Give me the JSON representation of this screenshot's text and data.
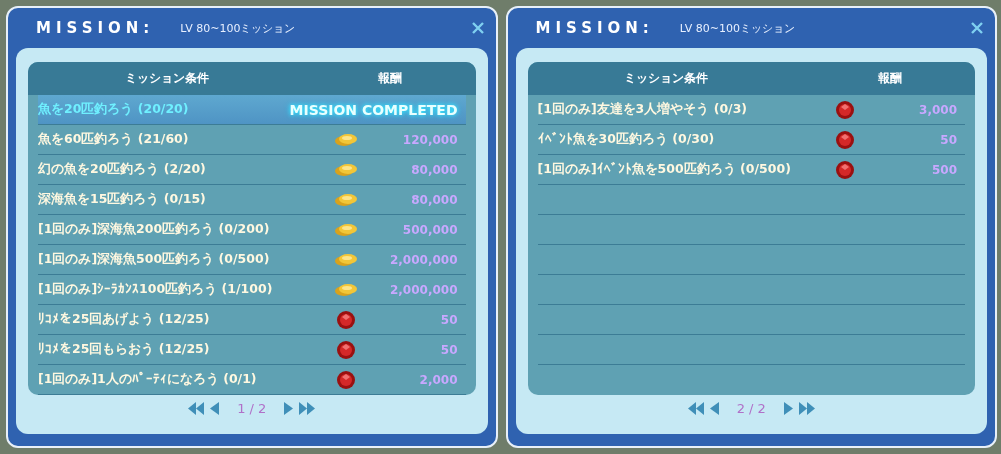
{
  "panels": [
    {
      "title": "MISSION:",
      "subtitle": "LV 80~100ミッション",
      "columns": [
        "ミッション条件",
        "報酬"
      ],
      "rows": [
        {
          "kind": "completed",
          "selected": true,
          "condition": "魚を20匹釣ろう (20/20)",
          "status": "MISSION COMPLETED"
        },
        {
          "kind": "coin",
          "selected": false,
          "condition": "魚を60匹釣ろう (21/60)",
          "reward": "120,000"
        },
        {
          "kind": "coin",
          "selected": false,
          "condition": "幻の魚を20匹釣ろう (2/20)",
          "reward": "80,000"
        },
        {
          "kind": "coin",
          "selected": false,
          "condition": "深海魚を15匹釣ろう (0/15)",
          "reward": "80,000"
        },
        {
          "kind": "coin",
          "selected": false,
          "condition": "[1回のみ]深海魚200匹釣ろう (0/200)",
          "reward": "500,000"
        },
        {
          "kind": "coin",
          "selected": false,
          "condition": "[1回のみ]深海魚500匹釣ろう (0/500)",
          "reward": "2,000,000"
        },
        {
          "kind": "coin",
          "selected": false,
          "condition": "[1回のみ]ｼｰﾗｶﾝｽ100匹釣ろう (1/100)",
          "reward": "2,000,000"
        },
        {
          "kind": "gem",
          "selected": false,
          "condition": "ﾘｺﾒを25回あげよう (12/25)",
          "reward": "50"
        },
        {
          "kind": "gem",
          "selected": false,
          "condition": "ﾘｺﾒを25回もらおう (12/25)",
          "reward": "50"
        },
        {
          "kind": "gem",
          "selected": false,
          "condition": "[1回のみ]1人のﾊﾟｰﾃｨになろう (0/1)",
          "reward": "2,000"
        }
      ],
      "page": "1 / 2"
    },
    {
      "title": "MISSION:",
      "subtitle": "LV 80~100ミッション",
      "columns": [
        "ミッション条件",
        "報酬"
      ],
      "rows": [
        {
          "kind": "gem",
          "selected": false,
          "condition": "[1回のみ]友達を3人増やそう (0/3)",
          "reward": "3,000"
        },
        {
          "kind": "gem",
          "selected": false,
          "condition": "ｲﾍﾞﾝﾄ魚を30匹釣ろう (0/30)",
          "reward": "50"
        },
        {
          "kind": "gem",
          "selected": false,
          "condition": "[1回のみ]ｲﾍﾞﾝﾄ魚を500匹釣ろう (0/500)",
          "reward": "500"
        }
      ],
      "page": "2 / 2"
    }
  ]
}
